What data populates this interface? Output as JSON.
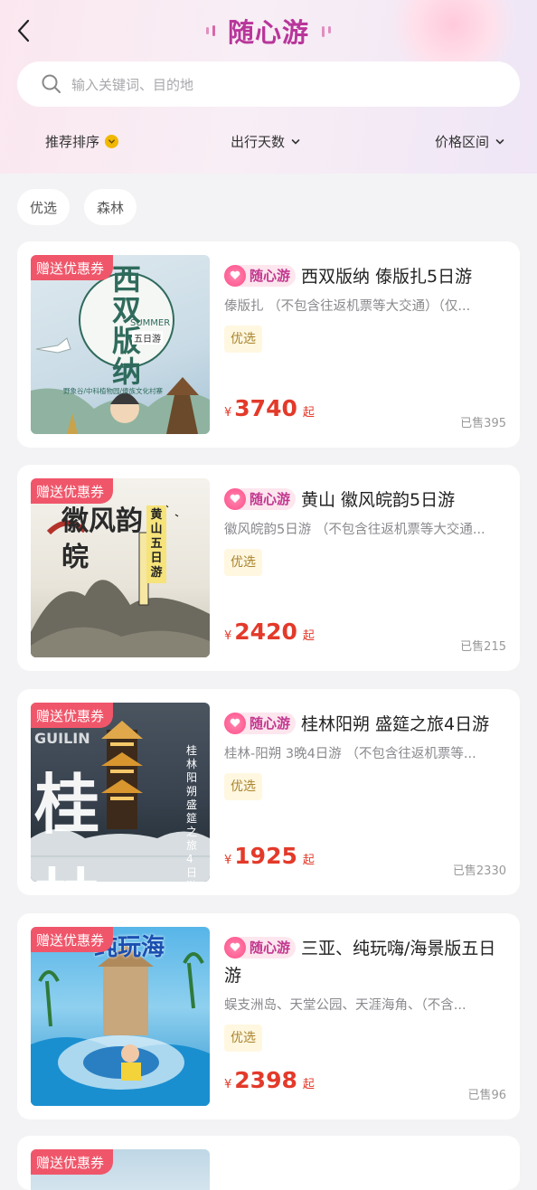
{
  "header": {
    "title": "随心游",
    "search_placeholder": "输入关键词、目的地"
  },
  "filters": {
    "sort_label": "推荐排序",
    "days_label": "出行天数",
    "price_label": "价格区间"
  },
  "tags": [
    "优选",
    "森林"
  ],
  "brand_label": "随心游",
  "ribbon_label": "赠送优惠券",
  "currency": "¥",
  "price_suffix": "起",
  "colors": {
    "accent": "#b8369a",
    "price": "#e33a2a",
    "ribbon": "#f0566a",
    "chip_bg": "#fff7e0"
  },
  "products": [
    {
      "title": "西双版纳 傣版扎5日游",
      "desc": "傣版扎 （不包含往返机票等大交通）（仅...",
      "chip": "优选",
      "price": "3740",
      "sold": "已售395",
      "thumb_text": "西双版纳",
      "thumb_sub": "五日游",
      "thumb_en": "SUMMER",
      "thumb_caption": "野象谷/中科植物园/傣族文化村寨"
    },
    {
      "title": "黄山 徽风皖韵5日游",
      "desc": "徽风皖韵5日游 （不包含往返机票等大交通...",
      "chip": "优选",
      "price": "2420",
      "sold": "已售215",
      "thumb_text": "徽风韵皖",
      "thumb_sub": "黄山五日游"
    },
    {
      "title": "桂林阳朔 盛筵之旅4日游",
      "desc": "桂林-阳朔 3晚4日游 （不包含往返机票等...",
      "chip": "优选",
      "price": "1925",
      "sold": "已售2330",
      "thumb_text": "桂林",
      "thumb_en": "GUILIN",
      "thumb_sub": "桂林阳朔盛筵之旅4日游"
    },
    {
      "title": "三亚、纯玩嗨/海景版五日游",
      "desc": "蜈支洲岛、天堂公园、天涯海角、（不含...",
      "chip": "优选",
      "price": "2398",
      "sold": "已售96",
      "thumb_text": "纯玩海"
    }
  ]
}
